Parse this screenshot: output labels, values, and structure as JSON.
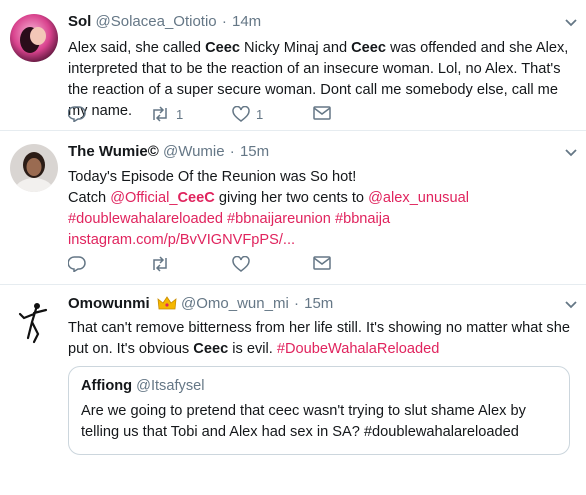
{
  "tweets": [
    {
      "name": "Sol",
      "handle": "@Solacea_Otiotio",
      "time": "14m",
      "text_parts": [
        "Alex said, she called ",
        "Ceec",
        " Nicky Minaj and ",
        "Ceec",
        " was offended and she Alex, interpreted that to be the reaction of an insecure woman. Lol, no Alex. That's the reaction of a super secure woman. Dont call me somebody else, call me my name."
      ],
      "retweet_count": "1",
      "like_count": "1"
    },
    {
      "name": "The Wumie©",
      "handle": "@Wumie",
      "time": "15m",
      "line1": "Today's Episode Of the Reunion was So hot!",
      "catch": "Catch ",
      "mention_official": "@Official_",
      "mention_official_bold": "CeeC",
      "giving": " giving her two cents to ",
      "mention_alex": "@alex_unusual",
      "hashtags": "#doublewahalareloaded #bbnaijareunion #bbnaija",
      "link": "instagram.com/p/BvVIGNVFpPS/..."
    },
    {
      "name": "Omowunmi",
      "handle": "@Omo_wun_mi",
      "time": "15m",
      "text_a": "That can't remove bitterness from her life still. It's showing  no matter what she put on. It's obvious ",
      "text_bold": "Ceec",
      "text_b": " is evil. ",
      "hashtag": "#DoubeWahalaReloaded",
      "quote": {
        "name": "Affiong",
        "handle": "@Itsafysel",
        "text": "Are we going to pretend that ceec wasn't trying to slut shame Alex by telling us that Tobi and Alex had sex in SA? #doublewahalareloaded"
      }
    }
  ],
  "icons": {
    "reply": "reply-icon",
    "retweet": "retweet-icon",
    "like": "heart-icon",
    "dm": "envelope-icon",
    "caret": "chevron-down-icon",
    "crown": "crown-emoji"
  },
  "colors": {
    "link": "#e0245e",
    "muted": "#657786",
    "divider": "#e6ecf0"
  }
}
